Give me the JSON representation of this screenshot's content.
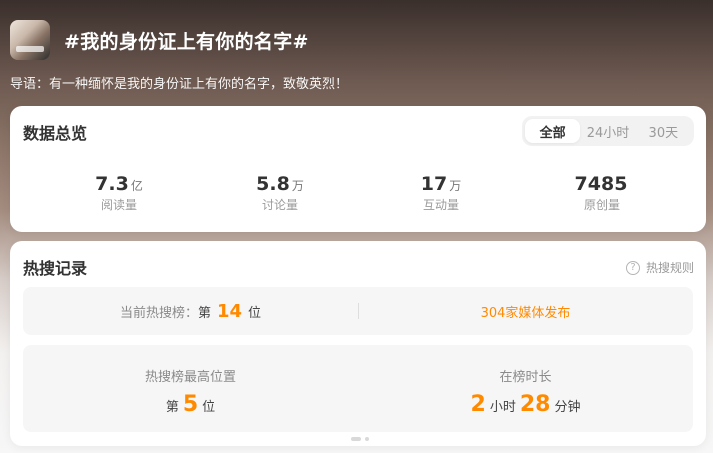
{
  "header": {
    "title": "#我的身份证上有你的名字#",
    "intro": "导语：有一种缅怀是我的身份证上有你的名字，致敬英烈！"
  },
  "overview": {
    "title": "数据总览",
    "tabs": [
      {
        "label": "全部",
        "active": true
      },
      {
        "label": "24小时",
        "active": false
      },
      {
        "label": "30天",
        "active": false
      }
    ],
    "stats": [
      {
        "value": "7.3",
        "unit": "亿",
        "label": "阅读量"
      },
      {
        "value": "5.8",
        "unit": "万",
        "label": "讨论量"
      },
      {
        "value": "17",
        "unit": "万",
        "label": "互动量"
      },
      {
        "value": "7485",
        "unit": "",
        "label": "原创量"
      }
    ]
  },
  "hot": {
    "title": "热搜记录",
    "help_label": "热搜规则",
    "current_prefix": "当前热搜榜：",
    "current_di": "第",
    "current_rank": "14",
    "current_wei": "位",
    "media": "304家媒体发布",
    "peak_label": "热搜榜最高位置",
    "peak_di": "第",
    "peak_rank": "5",
    "peak_wei": "位",
    "duration_label": "在榜时长",
    "duration_hours": "2",
    "duration_hour_unit": "小时",
    "duration_minutes": "28",
    "duration_minute_unit": "分钟"
  },
  "colors": {
    "accent": "#ff8a00",
    "text": "#333333",
    "muted": "#9a9a9a"
  },
  "icons": {
    "help": "question-circle-icon"
  }
}
